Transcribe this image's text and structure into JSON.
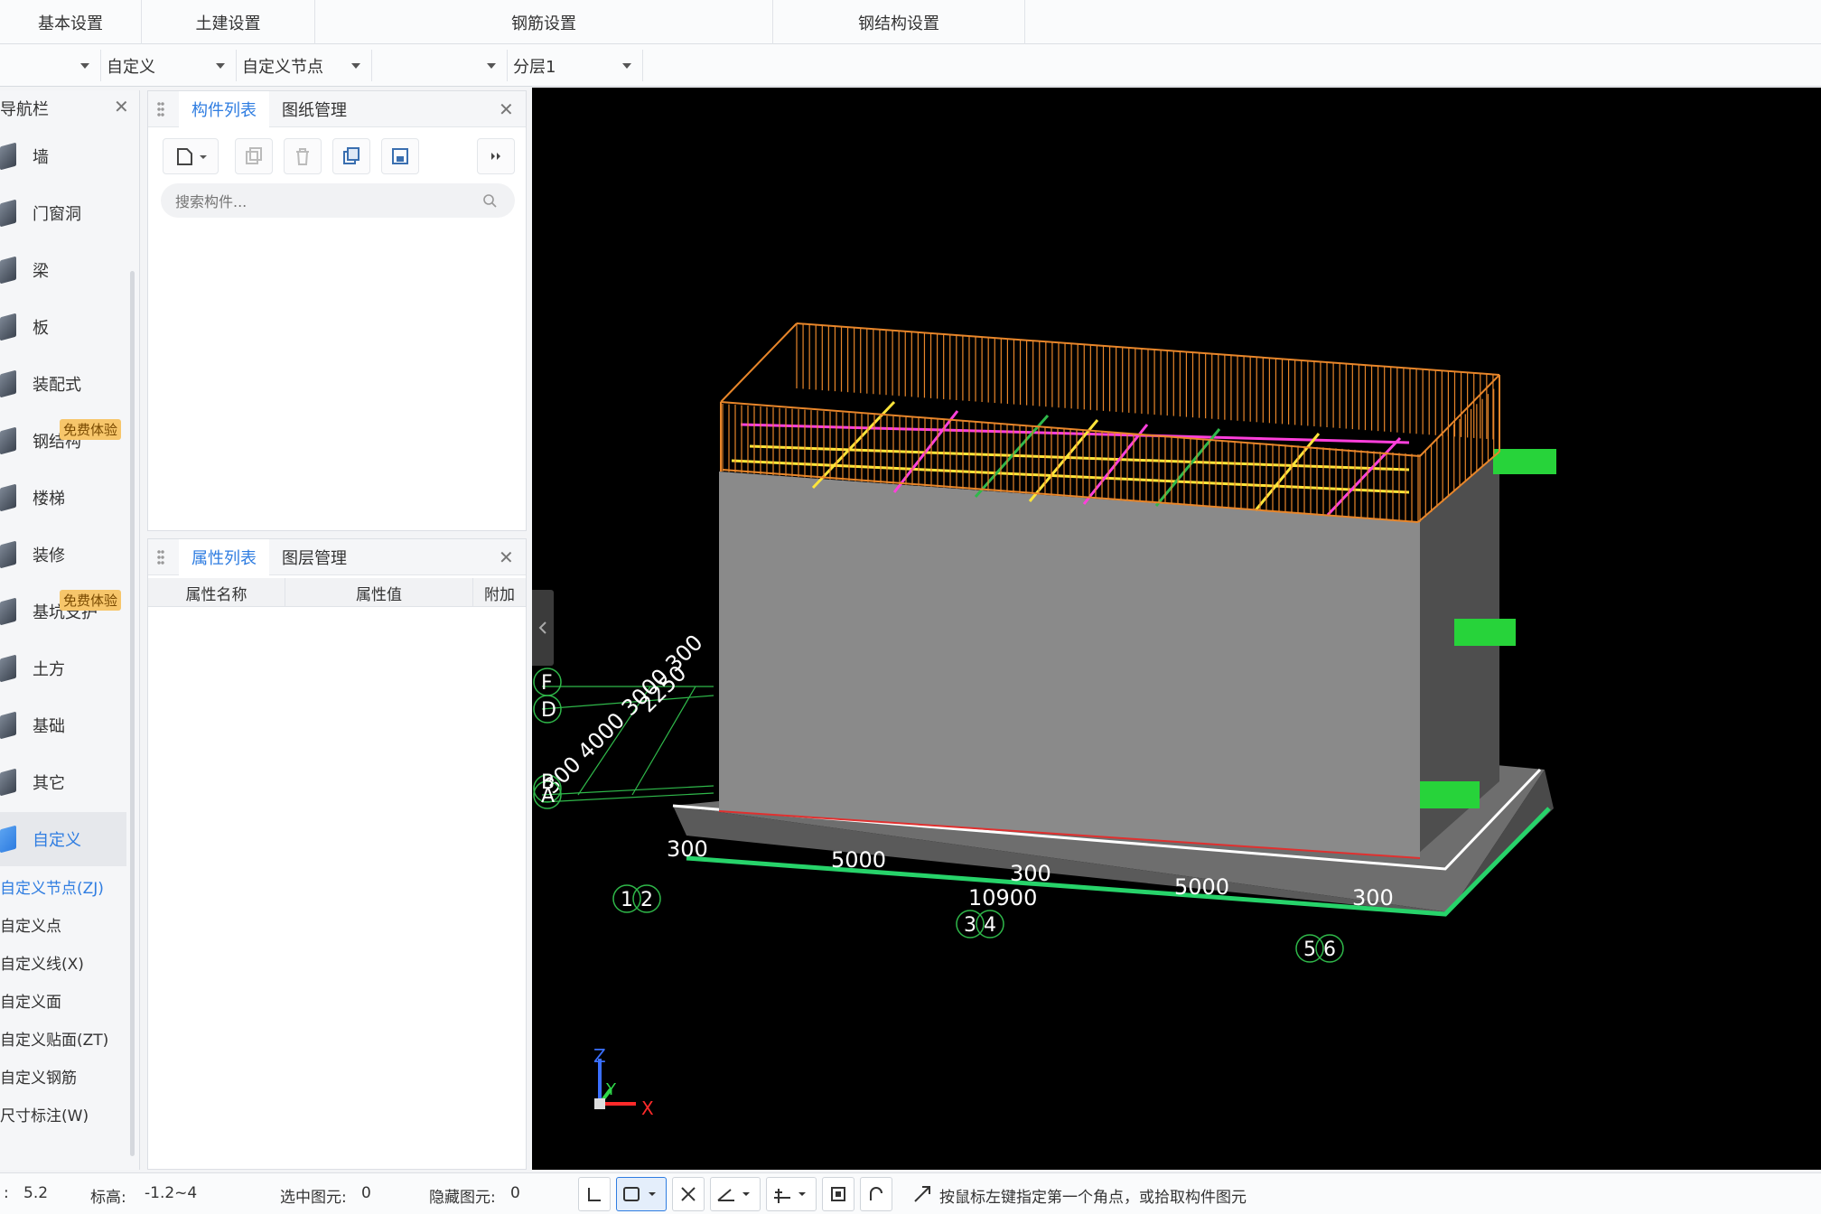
{
  "ribbon": {
    "groups": [
      "基本设置",
      "土建设置",
      "钢筋设置",
      "钢结构设置"
    ]
  },
  "selectors": {
    "sel0": "",
    "sel1": "自定义",
    "sel2": "自定义节点",
    "sel3": "",
    "sel4": "分层1"
  },
  "nav": {
    "title": "导航栏",
    "items": [
      "墙",
      "门窗洞",
      "梁",
      "板",
      "装配式",
      "钢结构",
      "楼梯",
      "装修",
      "基坑支护",
      "土方",
      "基础",
      "其它",
      "自定义"
    ],
    "badge": "免费体验",
    "sub_items": [
      "自定义节点(ZJ)",
      "自定义点",
      "自定义线(X)",
      "自定义面",
      "自定义贴面(ZT)",
      "自定义钢筋",
      "尺寸标注(W)"
    ]
  },
  "component_panel": {
    "tab_list": "构件列表",
    "tab_drawings": "图纸管理",
    "search_placeholder": "搜索构件..."
  },
  "property_panel": {
    "tab_props": "属性列表",
    "tab_layers": "图层管理",
    "col_name": "属性名称",
    "col_value": "属性值",
    "col_extra": "附加"
  },
  "viewport": {
    "grid_bottom_dims": [
      "300",
      "5000",
      "300",
      "5000",
      "300"
    ],
    "grid_total": "10900",
    "axis_bottom": [
      "1",
      "2",
      "3",
      "4",
      "5",
      "6"
    ],
    "axis_left": [
      "F",
      "D",
      "B",
      "A"
    ],
    "left_dims_text": "300 4000 3000 300",
    "left_dims_text2": "2250",
    "axes": {
      "x": "X",
      "y": "Y",
      "z": "Z"
    }
  },
  "status": {
    "scale_label": ":",
    "scale_value": "5.2",
    "elev_label": "标高:",
    "elev_value": "-1.2~4",
    "selected_label": "选中图元:",
    "selected_value": "0",
    "hidden_label": "隐藏图元:",
    "hidden_value": "0",
    "hint": "按鼠标左键指定第一个角点，或拾取构件图元"
  },
  "colors": {
    "accent": "#2f7de1",
    "viewport_bg": "#000000",
    "rail": "#e8862a",
    "wall": "#8a8a8a",
    "grid": "#2fb84a"
  }
}
